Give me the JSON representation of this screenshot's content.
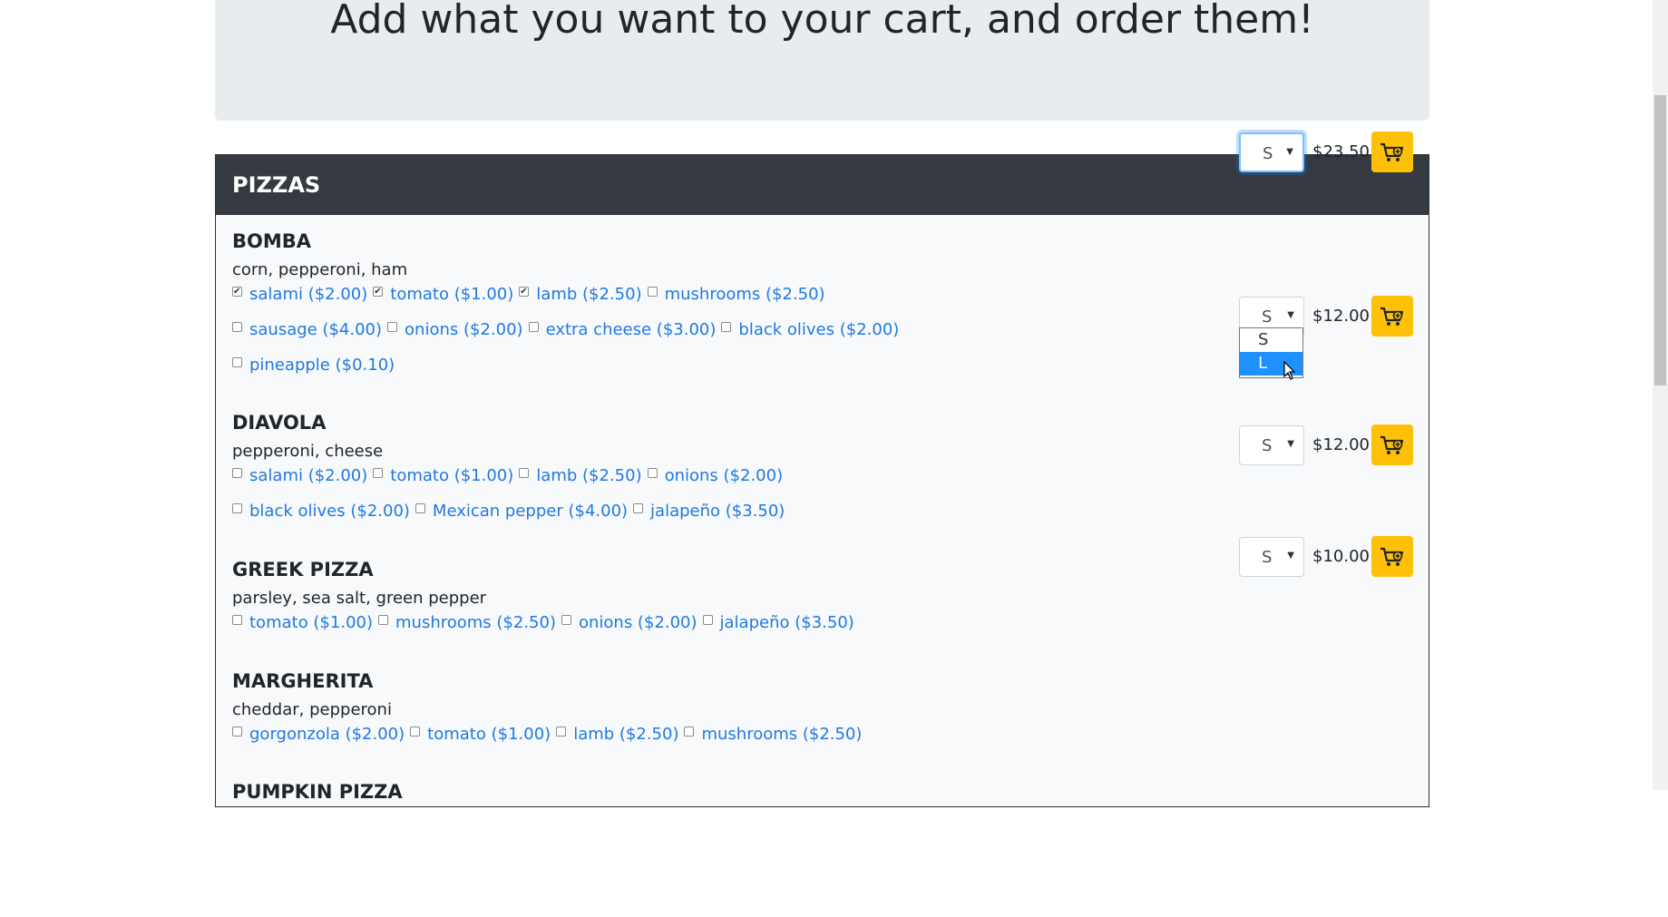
{
  "header": {
    "title": "Add what you want to your cart, and order them!"
  },
  "section": {
    "title": "PIZZAS"
  },
  "pizzas": [
    {
      "name": "BOMBA",
      "description": "corn, pepperoni, ham",
      "topping_rows": [
        [
          {
            "label": "salami ($2.00)",
            "checked": true
          },
          {
            "label": "tomato ($1.00)",
            "checked": true
          },
          {
            "label": "lamb ($2.50)",
            "checked": true
          },
          {
            "label": "mushrooms ($2.50)",
            "checked": false
          }
        ],
        [
          {
            "label": "sausage ($4.00)",
            "checked": false
          },
          {
            "label": "onions ($2.00)",
            "checked": false
          },
          {
            "label": "extra cheese ($3.00)",
            "checked": false
          },
          {
            "label": "black olives ($2.00)",
            "checked": false
          }
        ],
        [
          {
            "label": "pineapple ($0.10)",
            "checked": false
          }
        ]
      ],
      "size": "S",
      "price": "$23.50"
    },
    {
      "name": "DIAVOLA",
      "description": "pepperoni, cheese",
      "topping_rows": [
        [
          {
            "label": "salami ($2.00)",
            "checked": false
          },
          {
            "label": "tomato ($1.00)",
            "checked": false
          },
          {
            "label": "lamb ($2.50)",
            "checked": false
          },
          {
            "label": "onions ($2.00)",
            "checked": false
          }
        ],
        [
          {
            "label": "black olives ($2.00)",
            "checked": false
          },
          {
            "label": "Mexican pepper ($4.00)",
            "checked": false
          },
          {
            "label": "jalapeño ($3.50)",
            "checked": false
          }
        ]
      ],
      "size": "S",
      "price": "$12.00"
    },
    {
      "name": "GREEK PIZZA",
      "description": "parsley, sea salt, green pepper",
      "topping_rows": [
        [
          {
            "label": "tomato ($1.00)",
            "checked": false
          },
          {
            "label": "mushrooms ($2.50)",
            "checked": false
          },
          {
            "label": "onions ($2.00)",
            "checked": false
          },
          {
            "label": "jalapeño ($3.50)",
            "checked": false
          }
        ]
      ],
      "size": "S",
      "price": "$12.00"
    },
    {
      "name": "MARGHERITA",
      "description": "cheddar, pepperoni",
      "topping_rows": [
        [
          {
            "label": "gorgonzola ($2.00)",
            "checked": false
          },
          {
            "label": "tomato ($1.00)",
            "checked": false
          },
          {
            "label": "lamb ($2.50)",
            "checked": false
          },
          {
            "label": "mushrooms ($2.50)",
            "checked": false
          }
        ]
      ],
      "size": "S",
      "price": "$10.00"
    },
    {
      "name": "PUMPKIN PIZZA",
      "description": "",
      "topping_rows": [],
      "size": "",
      "price": ""
    }
  ],
  "size_dropdown": {
    "options": [
      "S",
      "L"
    ],
    "highlighted": "L"
  },
  "colors": {
    "accent_link": "#1f7ae0",
    "cart_button": "#ffc107",
    "section_header": "#343a40",
    "dropdown_highlight": "#1e90ff"
  },
  "icons": {
    "cart_button": "cart-plus-icon",
    "select": "chevron-down-icon"
  }
}
